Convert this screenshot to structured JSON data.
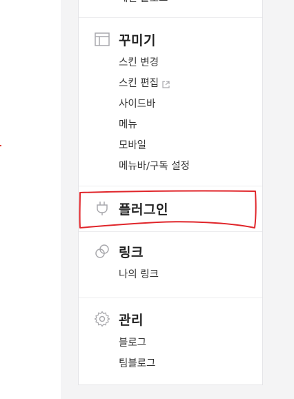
{
  "sidebar": {
    "top_cut_label": "메인 블로그",
    "sections": [
      {
        "title": "꾸미기",
        "icon": "layout-icon",
        "items": [
          {
            "label": "스킨 변경"
          },
          {
            "label": "스킨 편집",
            "external": true
          },
          {
            "label": "사이드바"
          },
          {
            "label": "메뉴"
          },
          {
            "label": "모바일"
          },
          {
            "label": "메뉴바/구독 설정"
          }
        ]
      },
      {
        "title": "플러그인",
        "icon": "plug-icon",
        "items": []
      },
      {
        "title": "링크",
        "icon": "link-icon",
        "items": [
          {
            "label": "나의 링크"
          }
        ]
      },
      {
        "title": "관리",
        "icon": "gear-icon",
        "items": [
          {
            "label": "블로그"
          },
          {
            "label": "팀블로그"
          }
        ]
      }
    ]
  },
  "colors": {
    "background": "#f4f4f5",
    "panel": "#ffffff",
    "text": "#222222",
    "icon": "#a9a9ad",
    "annotation": "#e0252a"
  }
}
